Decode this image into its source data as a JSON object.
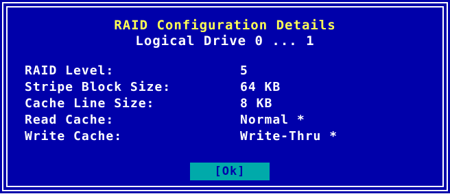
{
  "dialog": {
    "title": "RAID Configuration Details",
    "subtitle": "Logical Drive 0 ... 1"
  },
  "details": [
    {
      "label": "RAID Level:",
      "value": "5"
    },
    {
      "label": "Stripe Block Size:",
      "value": "64 KB"
    },
    {
      "label": "Cache Line Size:",
      "value": "8 KB"
    },
    {
      "label": "Read Cache:",
      "value": "Normal *"
    },
    {
      "label": "Write Cache:",
      "value": "Write-Thru *"
    }
  ],
  "buttons": {
    "ok_label": "[Ok]"
  },
  "colors": {
    "background": "#0000aa",
    "border": "#ffffff",
    "title": "#ffff55",
    "text": "#ffffff",
    "button_bg": "#00aaaa",
    "button_text": "#0000aa"
  }
}
